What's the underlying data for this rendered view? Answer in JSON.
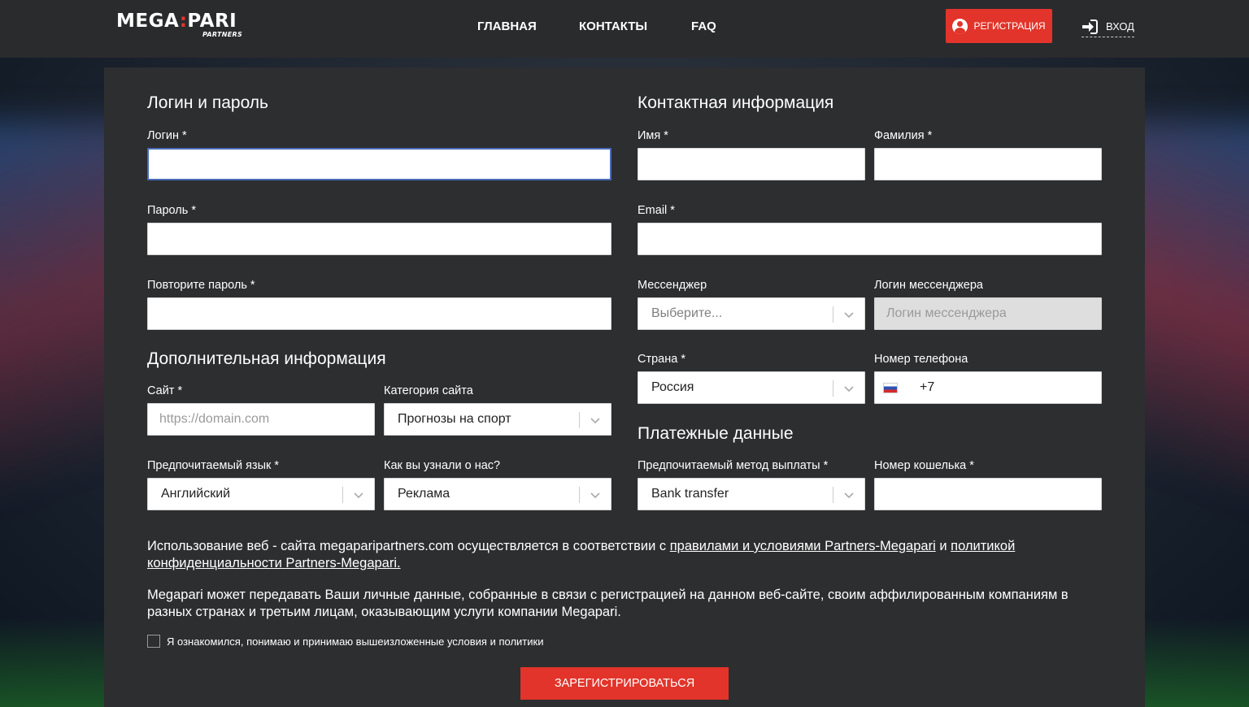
{
  "header": {
    "logo_main": "MEGA",
    "logo_dots": ":",
    "logo_main2": "PARI",
    "logo_sub": "PARTNERS",
    "nav": [
      {
        "label": "ГЛАВНАЯ"
      },
      {
        "label": "КОНТАКТЫ"
      },
      {
        "label": "FAQ"
      }
    ],
    "register_label": "РЕГИСТРАЦИЯ",
    "login_label": "ВХОД"
  },
  "form": {
    "login_section": {
      "title": "Логин и пароль",
      "login_label": "Логин *",
      "password_label": "Пароль *",
      "repeat_password_label": "Повторите пароль *"
    },
    "additional_section": {
      "title": "Дополнительная информация",
      "site_label": "Сайт *",
      "site_placeholder": "https://domain.com",
      "category_label": "Категория сайта",
      "category_value": "Прогнозы на спорт",
      "language_label": "Предпочитаемый язык *",
      "language_value": "Английский",
      "source_label": "Как вы узнали о нас?",
      "source_value": "Реклама"
    },
    "contact_section": {
      "title": "Контактная информация",
      "first_name_label": "Имя *",
      "last_name_label": "Фамилия *",
      "email_label": "Email *",
      "messenger_label": "Мессенджер",
      "messenger_placeholder": "Выберите...",
      "messenger_login_label": "Логин мессенджера",
      "messenger_login_placeholder": "Логин мессенджера",
      "country_label": "Страна *",
      "country_value": "Россия",
      "phone_label": "Номер телефона",
      "phone_code": "+7"
    },
    "payment_section": {
      "title": "Платежные данные",
      "method_label": "Предпочитаемый метод выплаты *",
      "method_value": "Bank transfer",
      "wallet_label": "Номер кошелька *"
    },
    "terms": {
      "p1_prefix": "Использование веб - сайта megaparipartners.com осуществляется в соответствии с ",
      "p1_link1": "правилами и условиями Partners-Megapari",
      "p1_mid": " и ",
      "p1_link2": "политикой конфиденциальности Partners-Megapari.",
      "p2": "Megapari может передавать Ваши личные данные, собранные в связи с регистрацией на данном веб-сайте, своим аффилированным компаниям в разных странах и третьим лицам, оказывающим услуги компании Megapari.",
      "checkbox_label": "Я ознакомился, понимаю и принимаю вышеизложенные условия и политики"
    },
    "submit_label": "ЗАРЕГИСТРИРОВАТЬСЯ"
  }
}
